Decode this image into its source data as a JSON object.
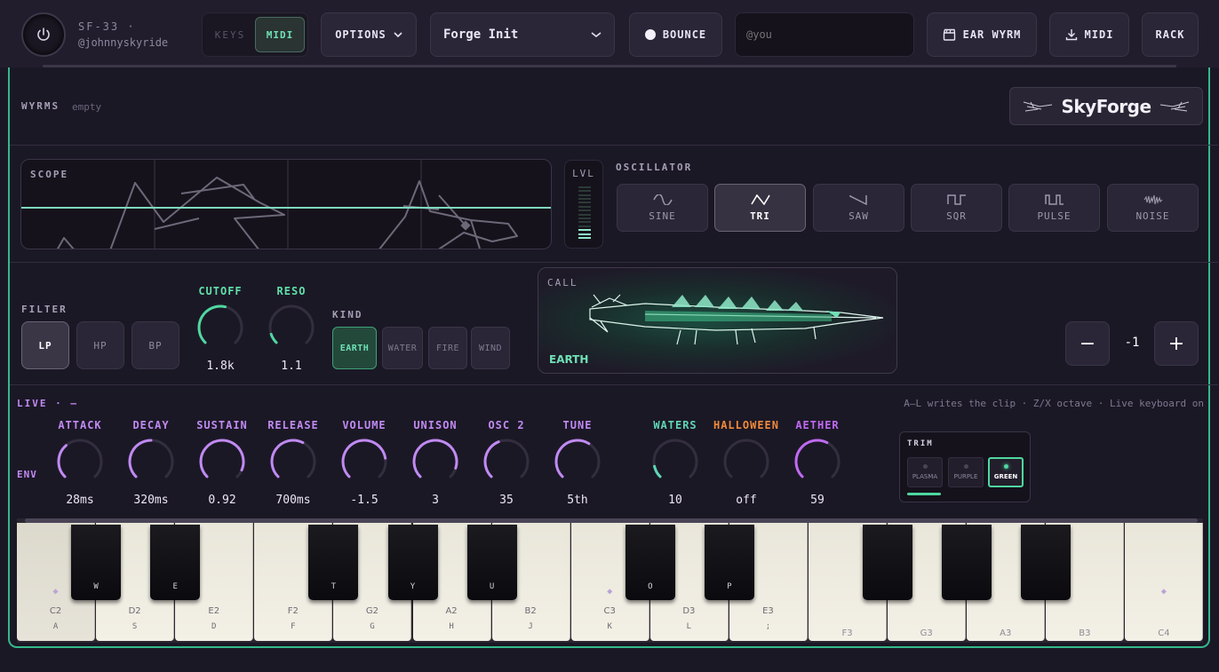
{
  "header": {
    "brand_name": "SF-33 ·",
    "user_handle": "@johnnyskyride",
    "mode_keys": "KEYS",
    "mode_midi": "MIDI",
    "options_label": "OPTIONS",
    "preset_value": "Forge Init",
    "bounce_label": "BOUNCE",
    "user_placeholder": "@you",
    "ear_wyrm_label": "EAR WYRM",
    "midi_export_label": "MIDI",
    "rack_label": "RACK"
  },
  "wyrms": {
    "label": "WYRMS",
    "status": "empty",
    "logo": "SkyForge"
  },
  "scope": {
    "label": "SCOPE"
  },
  "level": {
    "label": "LVL",
    "segments": 14,
    "lit_segments": 3
  },
  "oscillator": {
    "label": "OSCILLATOR",
    "waves": [
      {
        "label": "SINE",
        "icon": "sine-wave-icon"
      },
      {
        "label": "TRI",
        "icon": "triangle-wave-icon"
      },
      {
        "label": "SAW",
        "icon": "saw-wave-icon"
      },
      {
        "label": "SQR",
        "icon": "square-wave-icon"
      },
      {
        "label": "PULSE",
        "icon": "pulse-wave-icon"
      },
      {
        "label": "NOISE",
        "icon": "noise-wave-icon"
      }
    ],
    "selected": "TRI"
  },
  "filter": {
    "label": "FILTER",
    "modes": [
      "LP",
      "HP",
      "BP"
    ],
    "selected": "LP",
    "cutoff": {
      "label": "CUTOFF",
      "value": "1.8k",
      "level": 0.55
    },
    "reso": {
      "label": "RESO",
      "value": "1.1",
      "level": 0.1
    },
    "kind": {
      "label": "KIND",
      "options": [
        "EARTH",
        "WATER",
        "FIRE",
        "WIND"
      ],
      "selected": "EARTH"
    }
  },
  "call": {
    "label": "CALL",
    "name": "EARTH"
  },
  "octave": {
    "minus": "−",
    "value": "-1",
    "plus": "+"
  },
  "live": {
    "label": "LIVE · –",
    "env_label": "ENV",
    "hint": "A–L writes the clip · Z/X octave · Live keyboard on",
    "knobs": [
      {
        "label": "ATTACK",
        "value": "28ms",
        "level": 0.35,
        "color": "#c08af2"
      },
      {
        "label": "DECAY",
        "value": "320ms",
        "level": 0.5,
        "color": "#c08af2"
      },
      {
        "label": "SUSTAIN",
        "value": "0.92",
        "level": 0.92,
        "color": "#c08af2"
      },
      {
        "label": "RELEASE",
        "value": "700ms",
        "level": 0.6,
        "color": "#c08af2"
      },
      {
        "label": "VOLUME",
        "value": "-1.5",
        "level": 0.8,
        "color": "#c08af2"
      },
      {
        "label": "UNISON",
        "value": "3",
        "level": 0.9,
        "color": "#c08af2"
      },
      {
        "label": "OSC 2",
        "value": "35",
        "level": 0.42,
        "color": "#c08af2"
      },
      {
        "label": "TUNE",
        "value": "5th",
        "level": 0.62,
        "color": "#c08af2"
      },
      {
        "label": "WATERS",
        "value": "10",
        "level": 0.12,
        "color": "#5fd6b4"
      },
      {
        "label": "HALLOWEEN",
        "value": "off",
        "level": 0.0,
        "color": "#f08a3a"
      },
      {
        "label": "AETHER",
        "value": "59",
        "level": 0.6,
        "color": "#c06af2"
      }
    ]
  },
  "trim": {
    "label": "TRIM",
    "options": [
      "PLASMA",
      "PURPLE",
      "GREEN"
    ],
    "selected": "GREEN"
  },
  "keyboard": {
    "white_keys": [
      {
        "note": "C2",
        "key": "A",
        "marker": "◆"
      },
      {
        "note": "D2",
        "key": "S"
      },
      {
        "note": "E2",
        "key": "D"
      },
      {
        "note": "F2",
        "key": "F"
      },
      {
        "note": "G2",
        "key": "G"
      },
      {
        "note": "A2",
        "key": "H"
      },
      {
        "note": "B2",
        "key": "J"
      },
      {
        "note": "C3",
        "key": "K",
        "marker": "◆"
      },
      {
        "note": "D3",
        "key": "L"
      },
      {
        "note": "E3",
        "key": ";"
      },
      {
        "note": "F3"
      },
      {
        "note": "G3"
      },
      {
        "note": "A3"
      },
      {
        "note": "B3"
      },
      {
        "note": "C4",
        "marker": "◆"
      }
    ],
    "black_keys": [
      "W",
      "E",
      "T",
      "Y",
      "U",
      "O",
      "P",
      "",
      "",
      ""
    ]
  },
  "colors": {
    "accent_green": "#35b98a",
    "accent_purple": "#c08af2",
    "accent_orange": "#f08a3a"
  }
}
